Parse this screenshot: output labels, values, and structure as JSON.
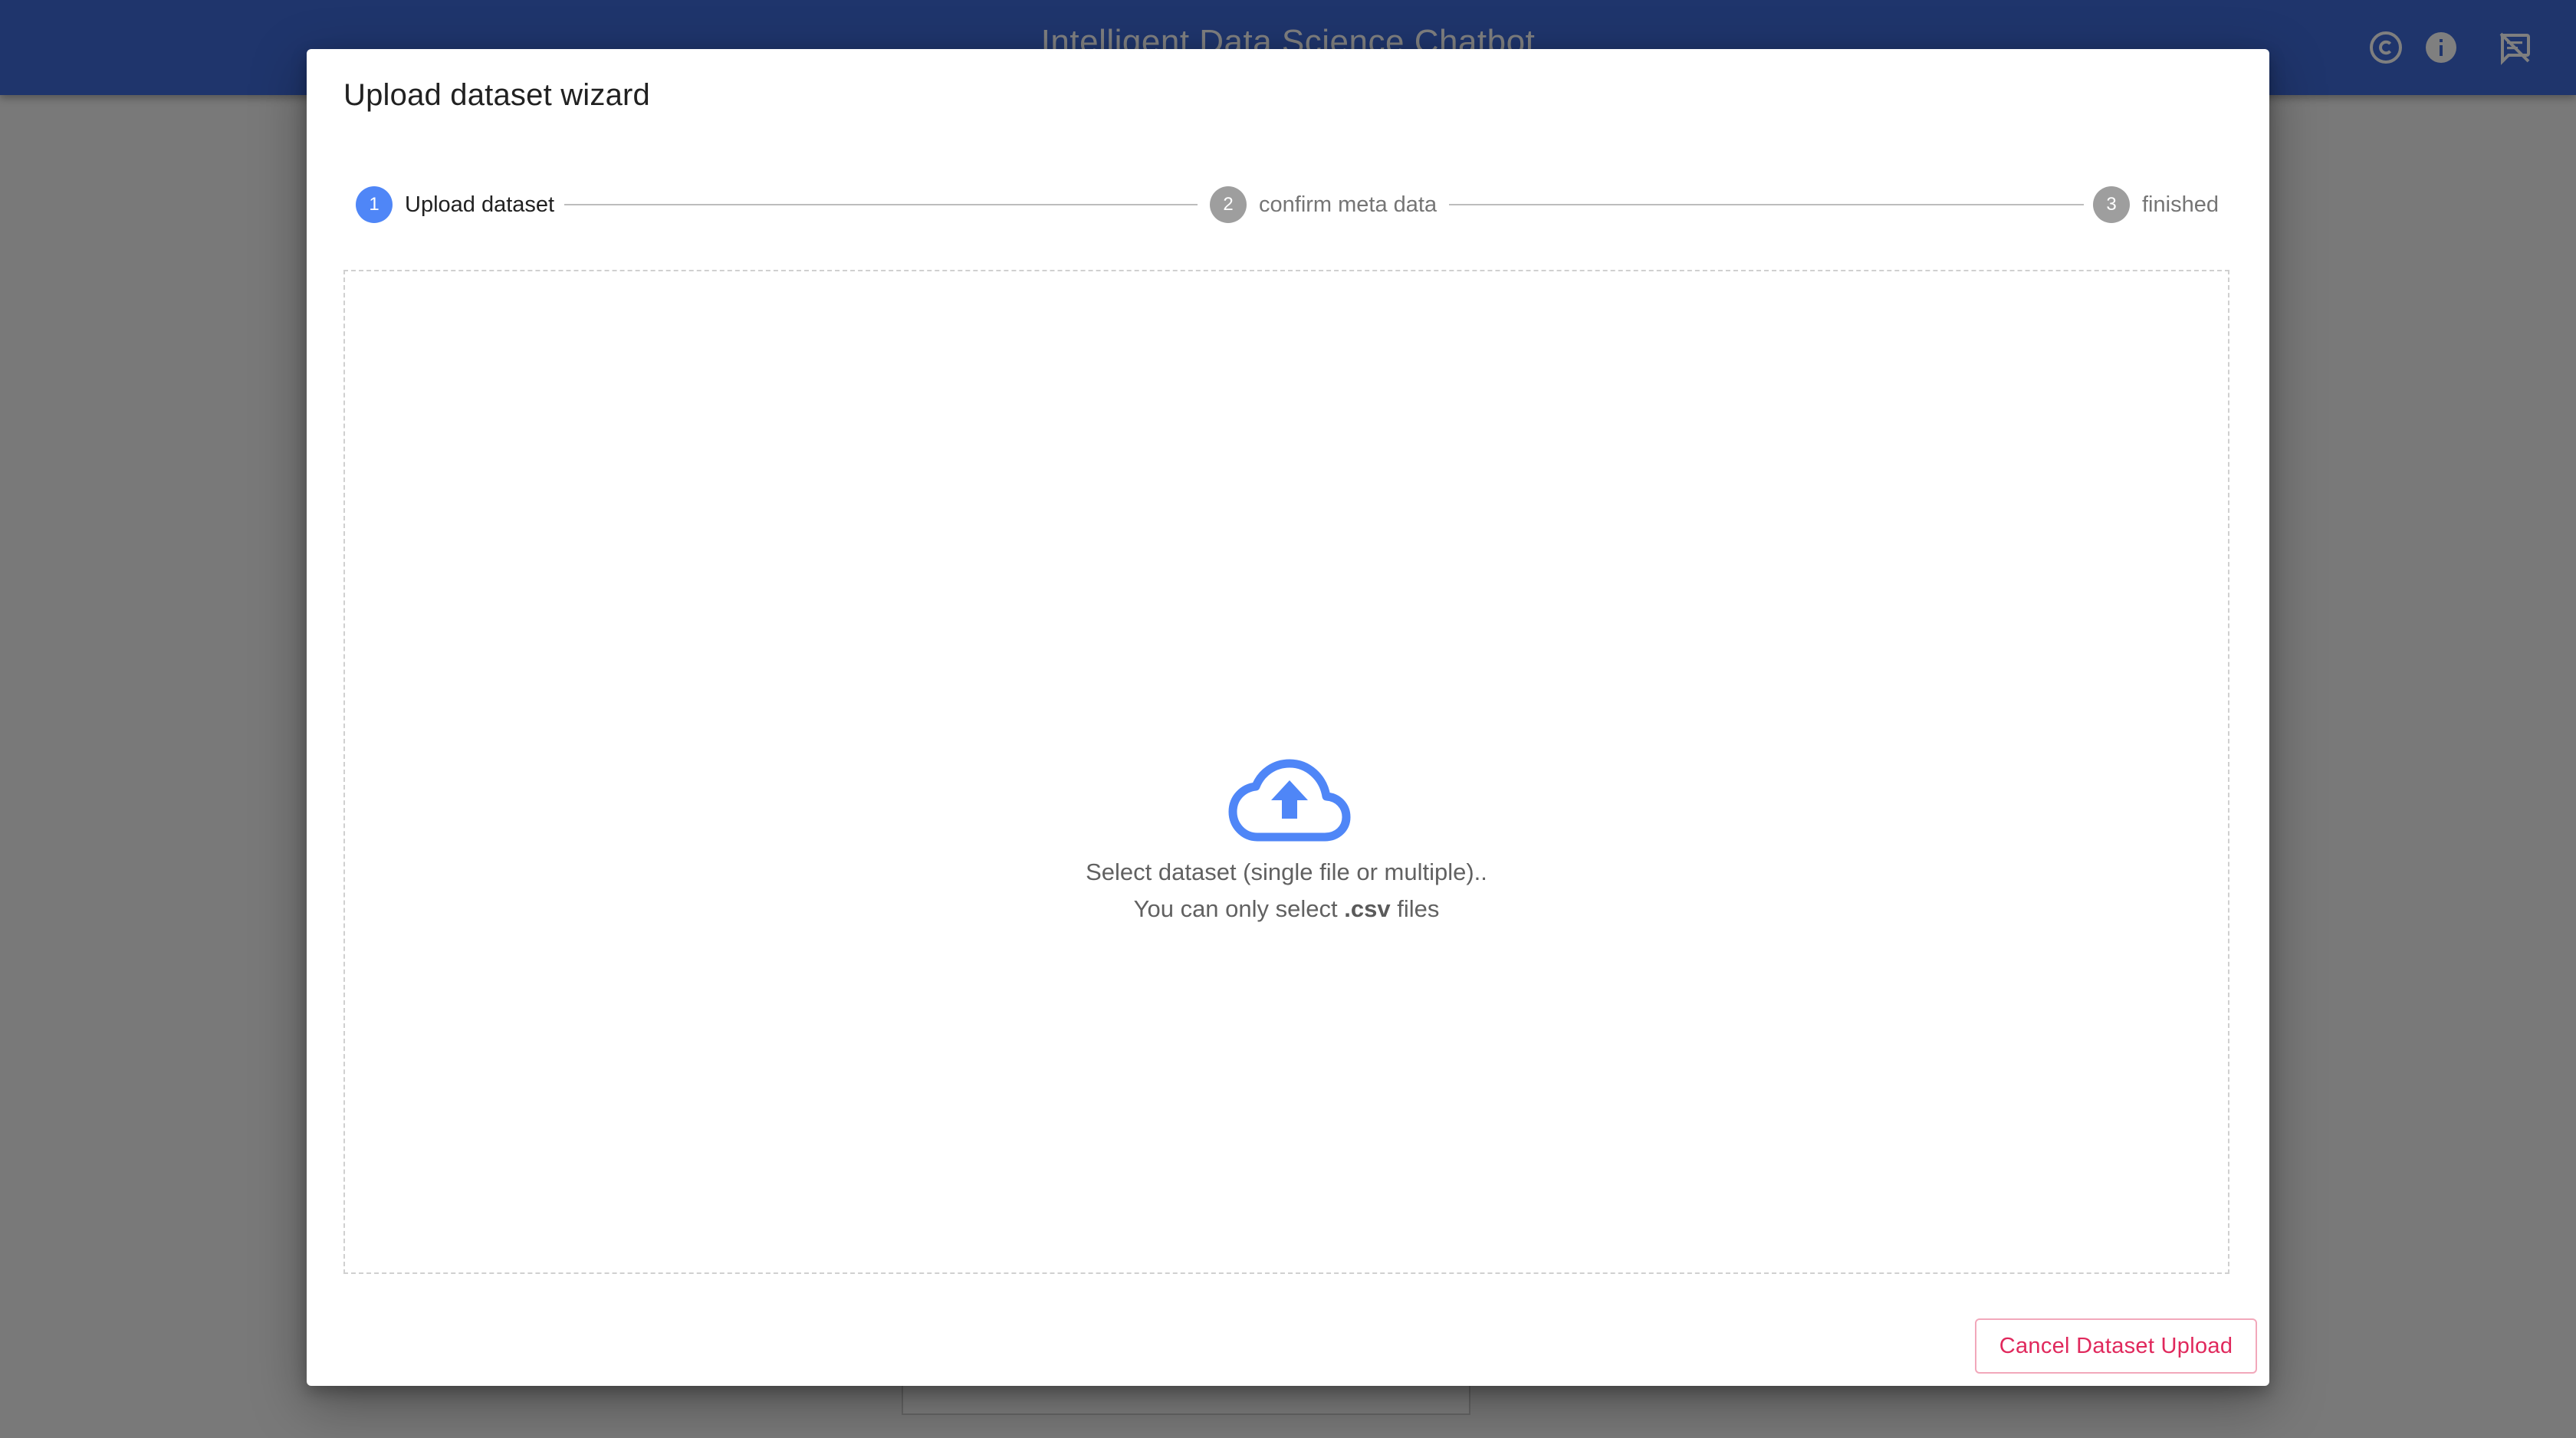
{
  "app_bar": {
    "title": "Intelligent Data Science Chatbot",
    "icons": [
      "copyright-icon",
      "info-icon",
      "speaker-notes-off-icon"
    ],
    "color": "#3f6bd8"
  },
  "dialog": {
    "title": "Upload dataset wizard",
    "steps": [
      {
        "number": "1",
        "label": "Upload dataset",
        "state": "active"
      },
      {
        "number": "2",
        "label": "confirm meta data",
        "state": "inactive"
      },
      {
        "number": "3",
        "label": "finished",
        "state": "inactive"
      }
    ],
    "dropzone": {
      "icon": "cloud-upload-icon",
      "line1": "Select dataset (single file or multiple)..",
      "line2_prefix": "You can only select ",
      "line2_bold": ".csv",
      "line2_suffix": " files"
    },
    "cancel_label": "Cancel Dataset Upload"
  },
  "colors": {
    "accent": "#4f86f7",
    "cancel": "#e0285c",
    "step_inactive": "#9e9e9e"
  }
}
